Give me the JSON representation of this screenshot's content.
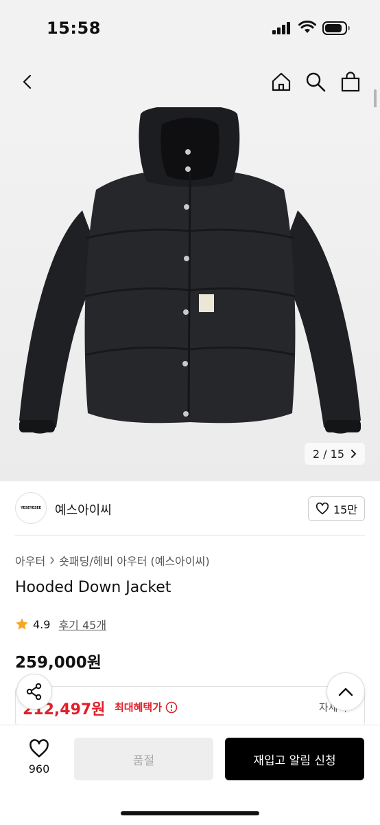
{
  "status_bar": {
    "time": "15:58"
  },
  "nav": {
    "back_icon": "chevron-left-icon",
    "home_icon": "home-icon",
    "search_icon": "search-icon",
    "cart_icon": "shopping-bag-icon"
  },
  "gallery": {
    "counter": "2 / 15"
  },
  "brand": {
    "logo_text": "YESEYESEE",
    "name": "예스아이씨",
    "likes": "15만"
  },
  "breadcrumb": {
    "level1": "아우터",
    "level2": "숏패딩/헤비 아우터 (예스아이씨)"
  },
  "product": {
    "title": "Hooded Down Jacket",
    "rating": "4.9",
    "reviews": "후기 45개",
    "price": "259,000원"
  },
  "benefit": {
    "price": "212,497원",
    "label": "최대혜택가",
    "detail": "자세히 ›"
  },
  "bottom": {
    "wish_count": "960",
    "soldout_label": "품절",
    "restock_label": "재입고 알림 신청"
  },
  "colors": {
    "accent_red": "#e0202a",
    "star": "#f5a623",
    "primary_button": "#000000",
    "disabled_button": "#eeeeee"
  }
}
